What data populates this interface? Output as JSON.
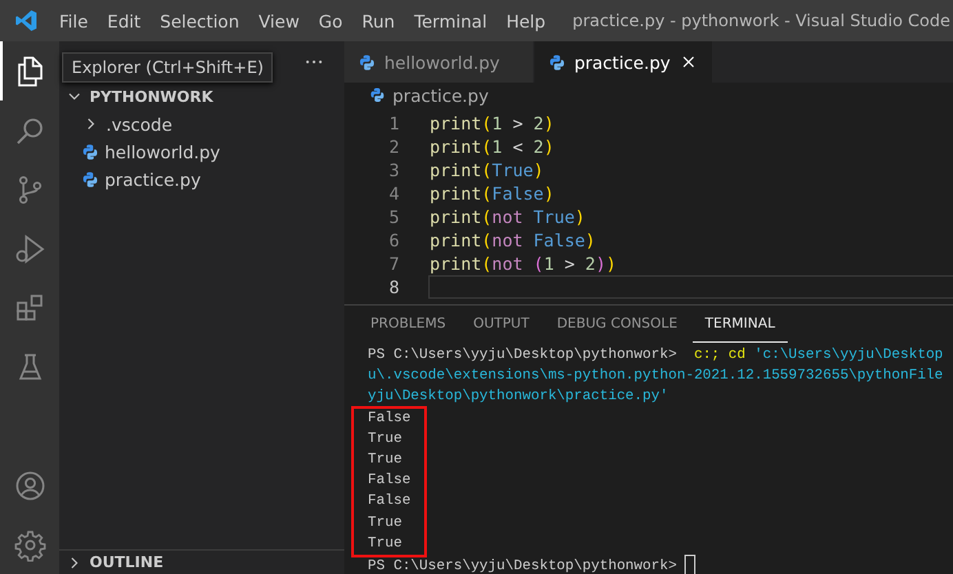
{
  "window": {
    "title": "practice.py - pythonwork - Visual Studio Code"
  },
  "menu": [
    "File",
    "Edit",
    "Selection",
    "View",
    "Go",
    "Run",
    "Terminal",
    "Help"
  ],
  "activity_bar": [
    {
      "kind": "explorer",
      "selected": true
    },
    {
      "kind": "search",
      "selected": false
    },
    {
      "kind": "source-control",
      "selected": false
    },
    {
      "kind": "run",
      "selected": false
    },
    {
      "kind": "extensions",
      "selected": false
    },
    {
      "kind": "testing",
      "selected": false
    },
    {
      "kind": "account",
      "selected": false
    },
    {
      "kind": "settings",
      "selected": false
    }
  ],
  "tooltip": "Explorer (Ctrl+Shift+E)",
  "sidebar": {
    "folder": {
      "label": "PYTHONWORK",
      "expanded": true,
      "children": [
        {
          "label": ".vscode",
          "kind": "folder",
          "expanded": false
        },
        {
          "label": "helloworld.py",
          "kind": "python"
        },
        {
          "label": "practice.py",
          "kind": "python"
        }
      ]
    },
    "outline": {
      "label": "OUTLINE",
      "expanded": false
    }
  },
  "tabs": [
    {
      "label": "helloworld.py",
      "selected": false
    },
    {
      "label": "practice.py",
      "selected": true
    }
  ],
  "breadcrumb": "practice.py",
  "code": [
    {
      "number": "1",
      "current": false,
      "tokens": [
        {
          "kind": "fn",
          "text": "print"
        },
        {
          "kind": "paren",
          "text": "("
        },
        {
          "kind": "num",
          "text": "1"
        },
        {
          "kind": "op",
          "text": " > "
        },
        {
          "kind": "num",
          "text": "2"
        },
        {
          "kind": "paren",
          "text": ")"
        }
      ]
    },
    {
      "number": "2",
      "current": false,
      "tokens": [
        {
          "kind": "fn",
          "text": "print"
        },
        {
          "kind": "paren",
          "text": "("
        },
        {
          "kind": "num",
          "text": "1"
        },
        {
          "kind": "op",
          "text": " < "
        },
        {
          "kind": "num",
          "text": "2"
        },
        {
          "kind": "paren",
          "text": ")"
        }
      ]
    },
    {
      "number": "3",
      "current": false,
      "tokens": [
        {
          "kind": "fn",
          "text": "print"
        },
        {
          "kind": "paren",
          "text": "("
        },
        {
          "kind": "const",
          "text": "True"
        },
        {
          "kind": "paren",
          "text": ")"
        }
      ]
    },
    {
      "number": "4",
      "current": false,
      "tokens": [
        {
          "kind": "fn",
          "text": "print"
        },
        {
          "kind": "paren",
          "text": "("
        },
        {
          "kind": "const",
          "text": "False"
        },
        {
          "kind": "paren",
          "text": ")"
        }
      ]
    },
    {
      "number": "5",
      "current": false,
      "tokens": [
        {
          "kind": "fn",
          "text": "print"
        },
        {
          "kind": "paren",
          "text": "("
        },
        {
          "kind": "kw",
          "text": "not "
        },
        {
          "kind": "const",
          "text": "True"
        },
        {
          "kind": "paren",
          "text": ")"
        }
      ]
    },
    {
      "number": "6",
      "current": false,
      "tokens": [
        {
          "kind": "fn",
          "text": "print"
        },
        {
          "kind": "paren",
          "text": "("
        },
        {
          "kind": "kw",
          "text": "not "
        },
        {
          "kind": "const",
          "text": "False"
        },
        {
          "kind": "paren",
          "text": ")"
        }
      ]
    },
    {
      "number": "7",
      "current": false,
      "tokens": [
        {
          "kind": "fn",
          "text": "print"
        },
        {
          "kind": "paren",
          "text": "("
        },
        {
          "kind": "kw",
          "text": "not "
        },
        {
          "kind": "paren2",
          "text": "("
        },
        {
          "kind": "num",
          "text": "1"
        },
        {
          "kind": "op",
          "text": " > "
        },
        {
          "kind": "num",
          "text": "2"
        },
        {
          "kind": "paren2",
          "text": ")"
        },
        {
          "kind": "paren",
          "text": ")"
        }
      ]
    },
    {
      "number": "8",
      "current": true
    }
  ],
  "panel": {
    "tabs": [
      {
        "label": "PROBLEMS",
        "selected": false
      },
      {
        "label": "OUTPUT",
        "selected": false
      },
      {
        "label": "DEBUG CONSOLE",
        "selected": false
      },
      {
        "label": "TERMINAL",
        "selected": true
      }
    ],
    "command_lines": [
      [
        {
          "kind": "prompt",
          "text": "PS C:\\Users\\yyju\\Desktop\\pythonwork> "
        },
        {
          "kind": "cmd",
          "text": " c:; cd "
        },
        {
          "kind": "string",
          "text": "'c:\\Users\\yyju\\Desktop"
        }
      ],
      [
        {
          "kind": "string",
          "text": "u\\.vscode\\extensions\\ms-python.python-2021.12.1559732655\\pythonFile"
        }
      ],
      [
        {
          "kind": "string",
          "text": "yju\\Desktop\\pythonwork\\practice.py'"
        }
      ]
    ],
    "output": {
      "highlighted": true,
      "lines": [
        "False",
        "True",
        "True",
        "False",
        "False",
        "True",
        "True"
      ]
    },
    "prompt": "PS C:\\Users\\yyju\\Desktop\\pythonwork>"
  }
}
